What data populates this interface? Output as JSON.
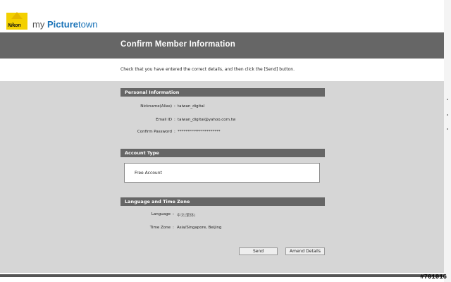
{
  "header": {
    "logo_text": "Nikon",
    "brand_my": "my ",
    "brand_picture": "Picture",
    "brand_town": "town"
  },
  "page_title": "Confirm Member Information",
  "instruction": "Check that you have entered the correct details, and then click the [Send] button.",
  "personal": {
    "heading": "Personal Information",
    "rows": [
      {
        "label": "Nickname(Alias)",
        "value": "taiwan_digital"
      },
      {
        "label": "Email ID",
        "value": "taiwan_digital@yahoo.com.tw"
      },
      {
        "label": "Confirm Password",
        "value": "**********************"
      }
    ]
  },
  "account": {
    "heading": "Account Type",
    "value": "Free Account"
  },
  "language": {
    "heading": "Language and Time Zone",
    "rows": [
      {
        "label": "Language",
        "value": "中文(繁体)"
      },
      {
        "label": "Time Zone",
        "value": "Asia/Singapore, Beijing"
      }
    ]
  },
  "separator": ":",
  "buttons": {
    "send": "Send",
    "amend": "Amend Details"
  },
  "watermark": "#701016"
}
